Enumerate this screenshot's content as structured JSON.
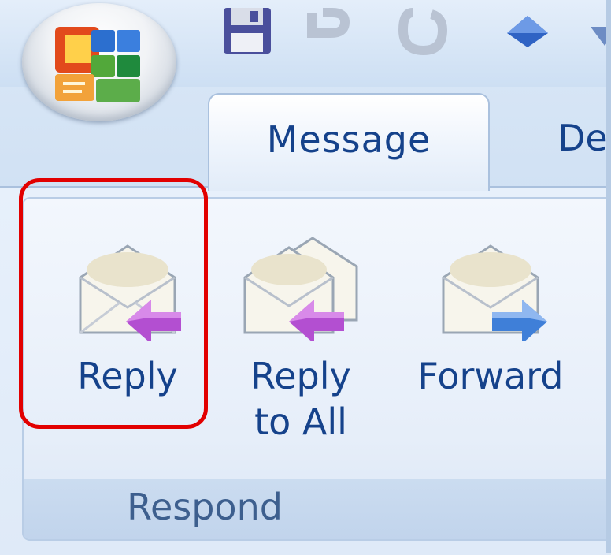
{
  "titlebar": {
    "quick_access_icons": [
      "save-icon",
      "undo-icon",
      "redo-icon",
      "up-arrow-icon",
      "down-arrow-icon"
    ]
  },
  "tabs": [
    {
      "label": "Message",
      "selected": true
    },
    {
      "label": "De",
      "selected": false
    }
  ],
  "ribbon": {
    "group": {
      "label": "Respond",
      "buttons": [
        {
          "label": "Reply",
          "icon": "reply-icon"
        },
        {
          "label_line1": "Reply",
          "label_line2": "to All",
          "icon": "reply-all-icon"
        },
        {
          "label": "Forward",
          "icon": "forward-icon"
        }
      ]
    }
  },
  "annotation": {
    "highlight_color": "#e20000",
    "target": "Reply"
  },
  "colors": {
    "tab_text": "#15428b",
    "group_label": "#3d5f8e",
    "reply_arrow": "#b34fd1",
    "forward_arrow": "#3f7fd8"
  }
}
